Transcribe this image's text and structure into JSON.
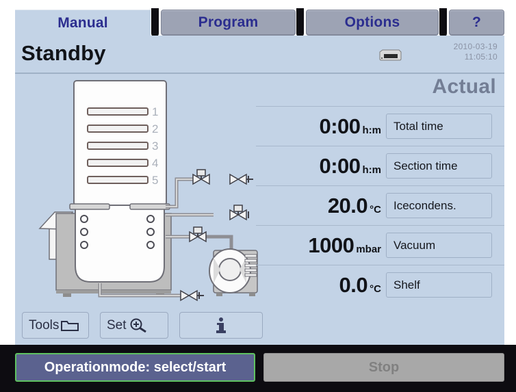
{
  "tabs": [
    {
      "label": "Manual",
      "active": true
    },
    {
      "label": "Program",
      "active": false
    },
    {
      "label": "Options",
      "active": false
    },
    {
      "label": "?",
      "active": false
    }
  ],
  "header": {
    "status": "Standby",
    "date": "2010-03-19",
    "time": "11:05:10",
    "drive_icon": "drive-icon"
  },
  "main": {
    "column_title": "Actual",
    "measurements": [
      {
        "value": "0:00",
        "unit": "h:m",
        "label": "Total time"
      },
      {
        "value": "0:00",
        "unit": "h:m",
        "label": "Section time"
      },
      {
        "value": "20.0",
        "unit": "°C",
        "label": "Icecondens."
      },
      {
        "value": "1000",
        "unit": "mbar",
        "label": "Vacuum"
      },
      {
        "value": "0.0",
        "unit": "°C",
        "label": "Shelf"
      }
    ],
    "shelf_numbers": [
      "1",
      "2",
      "3",
      "4",
      "5"
    ]
  },
  "toolbar": {
    "tools_label": "Tools",
    "tools_icon": "folder-icon",
    "set_label": "Set",
    "set_icon": "magnifier-plus-icon",
    "info_icon": "info-icon"
  },
  "actions": {
    "operationmode_label": "Operationmode: select/start",
    "stop_label": "Stop"
  },
  "colors": {
    "panel_bg": "#c3d3e6",
    "tab_active_bg": "#c3d3e6",
    "tab_inactive_bg": "#9da3b4",
    "tab_text": "#2b2d8f",
    "actual_title": "#737e95",
    "opmode_bg": "#5b628f",
    "opmode_border": "#5fc261",
    "stop_bg": "#a8a8a8",
    "bottom_bar": "#0d0c11"
  }
}
